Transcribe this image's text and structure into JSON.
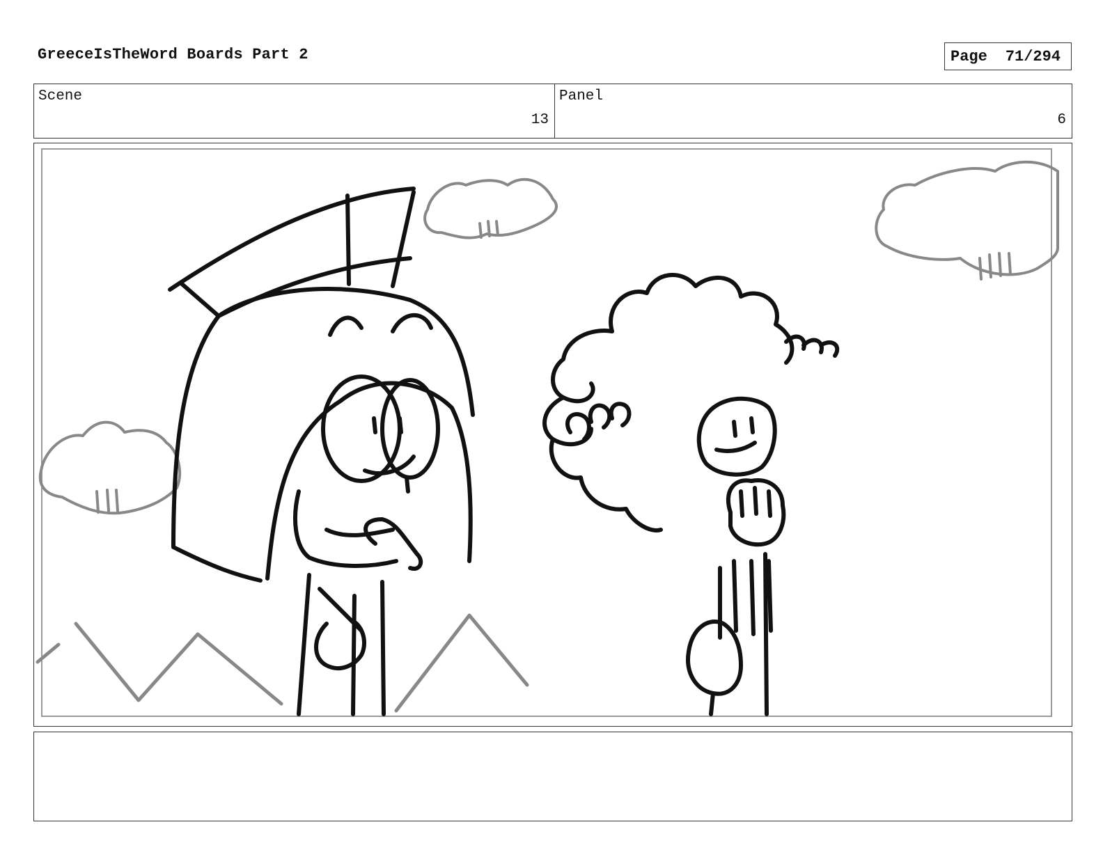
{
  "header": {
    "title": "GreeceIsTheWord Boards Part 2",
    "page_label": "Page",
    "page_number": "71/294"
  },
  "info": {
    "scene_label": "Scene",
    "scene_value": "13",
    "panel_label": "Panel",
    "panel_value": "6"
  },
  "notes": {
    "text": ""
  }
}
